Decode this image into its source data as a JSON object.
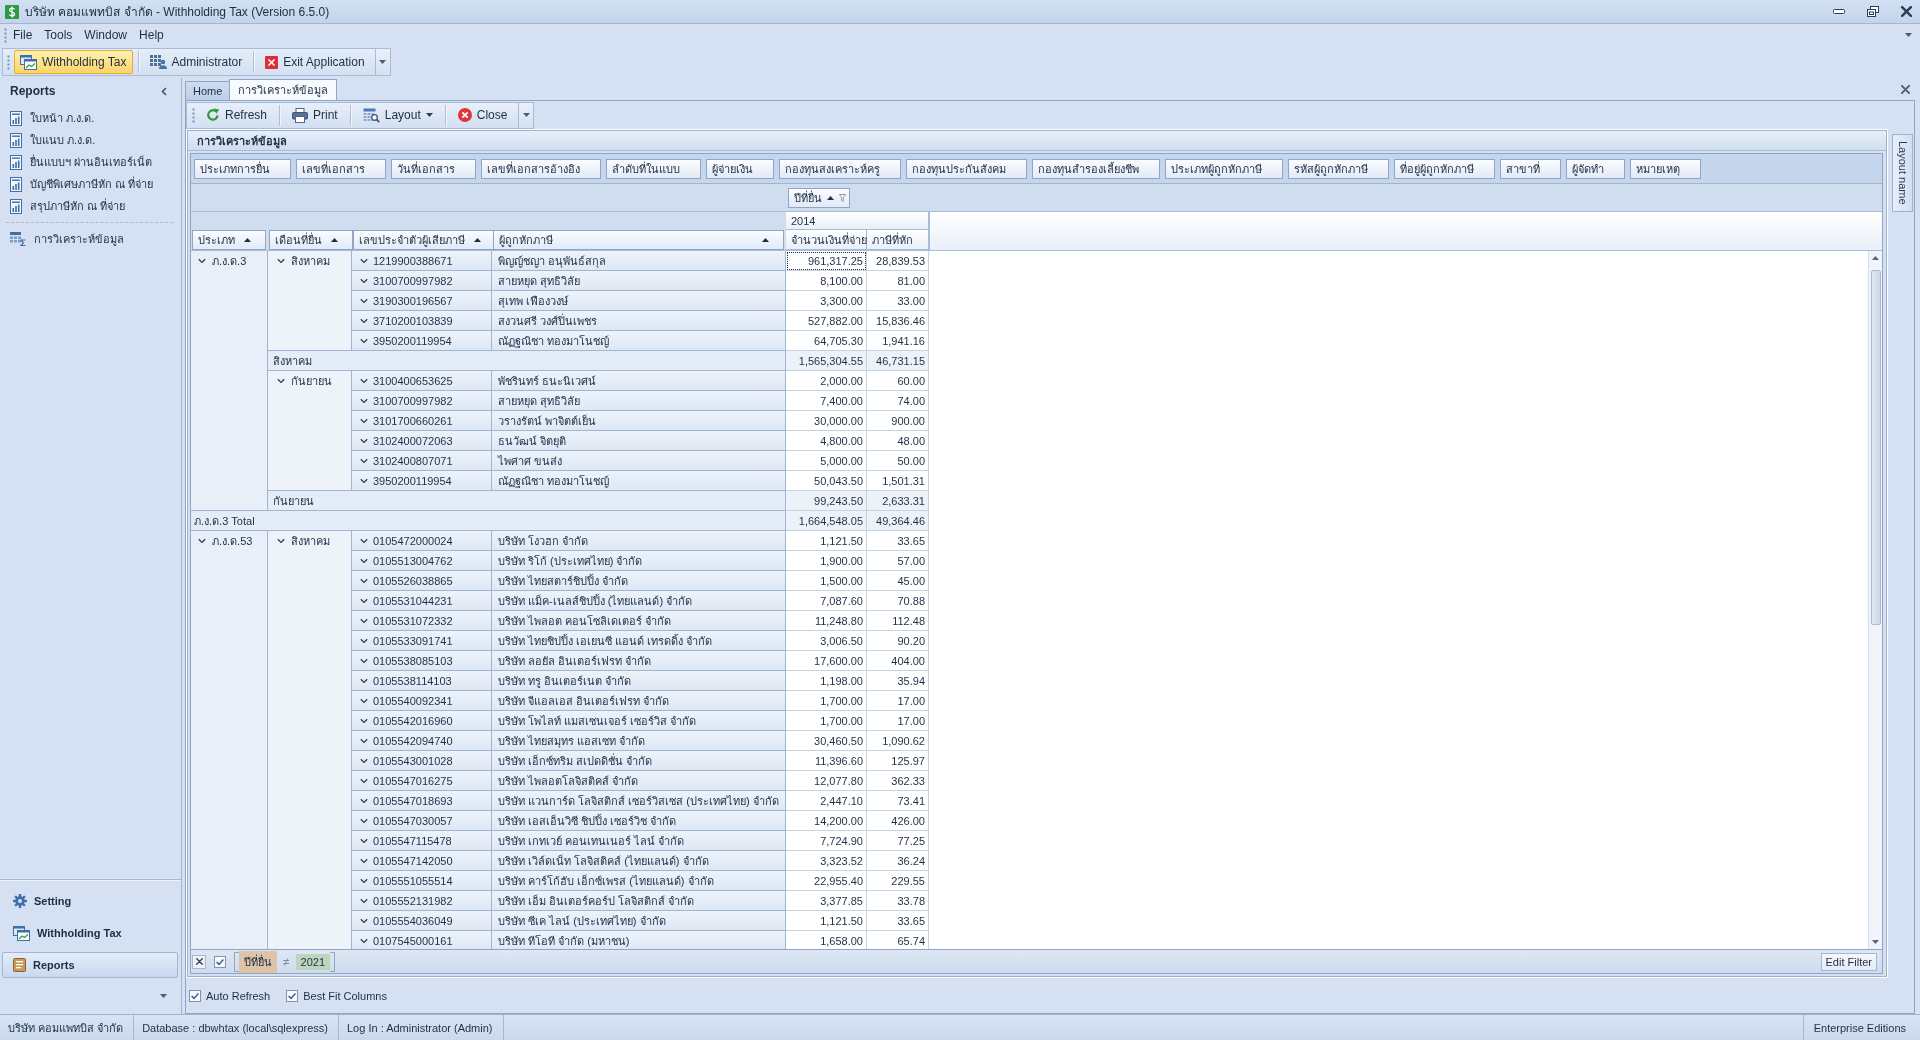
{
  "window": {
    "title": "บริษัท คอมแพทบิส จำกัด - Withholding Tax (Version 6.5.0)"
  },
  "menu": [
    "File",
    "Tools",
    "Window",
    "Help"
  ],
  "toolbar": [
    {
      "label": "Withholding Tax",
      "kind": "module",
      "selected": true
    },
    {
      "label": "Administrator",
      "kind": "admin",
      "selected": false
    },
    {
      "label": "Exit Application",
      "kind": "exit",
      "selected": false
    }
  ],
  "sidebar": {
    "title": "Reports",
    "items": [
      {
        "label": "ใบหน้า ภ.ง.ด.",
        "kind": "report",
        "selected": false
      },
      {
        "label": "ใบแนบ ภ.ง.ด.",
        "kind": "report",
        "selected": false
      },
      {
        "label": "ยื่นแบบฯ ผ่านอินเทอร์เน็ต",
        "kind": "report",
        "selected": false
      },
      {
        "label": "บัญชีพิเศษภาษีหัก ณ ที่จ่าย",
        "kind": "report",
        "selected": false
      },
      {
        "label": "สรุปภาษีหัก ณ ที่จ่าย",
        "kind": "report",
        "selected": false
      },
      {
        "label": "การวิเคราะห์ข้อมูล",
        "kind": "analysis",
        "selected": false
      }
    ],
    "sections": [
      {
        "label": "Setting",
        "kind": "setting",
        "selected": false
      },
      {
        "label": "Withholding Tax",
        "kind": "module",
        "selected": false
      },
      {
        "label": "Reports",
        "kind": "reports",
        "selected": true
      }
    ]
  },
  "tabs": [
    {
      "label": "Home",
      "selected": false
    },
    {
      "label": "การวิเคราะห์ข้อมูล",
      "selected": true
    }
  ],
  "document_toolbar": [
    {
      "label": "Refresh",
      "kind": "refresh",
      "dropdown": false
    },
    {
      "label": "Print",
      "kind": "print",
      "dropdown": false
    },
    {
      "label": "Layout",
      "kind": "layout",
      "dropdown": true
    },
    {
      "label": "Close",
      "kind": "close",
      "dropdown": false
    }
  ],
  "panel": {
    "title": "การวิเคราะห์ข้อมูล"
  },
  "pivot": {
    "filter_fields": [
      "ประเภทการยื่น",
      "เลขที่เอกสาร",
      "วันที่เอกสาร",
      "เลขที่เอกสารอ้างอิง",
      "ลำดับที่ในแบบ",
      "ผู้จ่ายเงิน",
      "กองทุนสงเคราะห์ครู",
      "กองทุนประกันสังคม",
      "กองทุนสำรองเลี้ยงชีพ",
      "ประเภทผู้ถูกหักภาษี",
      "รหัสผู้ถูกหักภาษี",
      "ที่อยู่ผู้ถูกหักภาษี",
      "สาขาที่",
      "ผู้จัดทำ",
      "หมายเหตุ"
    ],
    "column_fields": [
      {
        "label": "ปีที่ยื่น",
        "sorted": true,
        "filtered": true
      }
    ],
    "column_values": [
      "2014"
    ],
    "data_fields": [
      "จำนวนเงินที่จ่าย",
      "ภาษีที่หัก"
    ],
    "row_fields": [
      {
        "label": "ประเภท",
        "sorted": true
      },
      {
        "label": "เดือนที่ยื่น",
        "sorted": true
      },
      {
        "label": "เลขประจำตัวผู้เสียภาษี",
        "sorted": true
      },
      {
        "label": "ผู้ถูกหักภาษี",
        "sorted": true
      }
    ],
    "groups": [
      {
        "label": "ภ.ง.ด.3",
        "expanded": true,
        "children": [
          {
            "label": "สิงหาคม",
            "expanded": true,
            "children": [
              {
                "tax_id": "1219900388671",
                "name": "พิญญ์ชญา อนุพันธ์สกุล",
                "amount": "961,317.25",
                "tax": "28,839.53",
                "expanded": true,
                "focused": true
              },
              {
                "tax_id": "3100700997982",
                "name": "สายหยุด สุทธิวิลัย",
                "amount": "8,100.00",
                "tax": "81.00",
                "expanded": true,
                "focused": false
              },
              {
                "tax_id": "3190300196567",
                "name": "สุเทพ เฟืองวงษ์",
                "amount": "3,300.00",
                "tax": "33.00",
                "expanded": true,
                "focused": false
              },
              {
                "tax_id": "3710200103839",
                "name": "สงวนศรี วงศ์ปิ่นเพชร",
                "amount": "527,882.00",
                "tax": "15,836.46",
                "expanded": true,
                "focused": false
              },
              {
                "tax_id": "3950200119954",
                "name": "ณัฏฐณิชา ทองมาโนชญ์",
                "amount": "64,705.30",
                "tax": "1,941.16",
                "expanded": true,
                "focused": false
              }
            ],
            "total": {
              "label": "สิงหาคม",
              "amount": "1,565,304.55",
              "tax": "46,731.15"
            }
          },
          {
            "label": "กันยายน",
            "expanded": true,
            "children": [
              {
                "tax_id": "3100400653625",
                "name": "พัชรินทร์ ธนะนิเวศน์",
                "amount": "2,000.00",
                "tax": "60.00",
                "expanded": true,
                "focused": false
              },
              {
                "tax_id": "3100700997982",
                "name": "สายหยุด สุทธิวิลัย",
                "amount": "7,400.00",
                "tax": "74.00",
                "expanded": true,
                "focused": false
              },
              {
                "tax_id": "3101700660261",
                "name": "วรางรัตน์ พาจิตต์เย็น",
                "amount": "30,000.00",
                "tax": "900.00",
                "expanded": true,
                "focused": false
              },
              {
                "tax_id": "3102400072063",
                "name": "ธนวัฒน์ จิตยุติ",
                "amount": "4,800.00",
                "tax": "48.00",
                "expanded": true,
                "focused": false
              },
              {
                "tax_id": "3102400807071",
                "name": "ไพศาศ ขนส่ง",
                "amount": "5,000.00",
                "tax": "50.00",
                "expanded": true,
                "focused": false
              },
              {
                "tax_id": "3950200119954",
                "name": "ณัฏฐณิชา ทองมาโนชญ์",
                "amount": "50,043.50",
                "tax": "1,501.31",
                "expanded": true,
                "focused": false
              }
            ],
            "total": {
              "label": "กันยายน",
              "amount": "99,243.50",
              "tax": "2,633.31"
            }
          }
        ],
        "total": {
          "label": "ภ.ง.ด.3 Total",
          "amount": "1,664,548.05",
          "tax": "49,364.46"
        }
      },
      {
        "label": "ภ.ง.ด.53",
        "expanded": true,
        "children": [
          {
            "label": "สิงหาคม",
            "expanded": true,
            "children": [
              {
                "tax_id": "0105472000024",
                "name": "บริษัท โงวฮก จำกัด",
                "amount": "1,121.50",
                "tax": "33.65",
                "expanded": true,
                "focused": false
              },
              {
                "tax_id": "0105513004762",
                "name": "บริษัท ริโก้ (ประเทศไทย) จำกัด",
                "amount": "1,900.00",
                "tax": "57.00",
                "expanded": true,
                "focused": false
              },
              {
                "tax_id": "0105526038865",
                "name": "บริษัท ไทยสตาร์ชิปปิ้ง จำกัด",
                "amount": "1,500.00",
                "tax": "45.00",
                "expanded": true,
                "focused": false
              },
              {
                "tax_id": "0105531044231",
                "name": "บริษัท แม็ค-เนลส์ชิปปิ้ง (ไทยแลนด์) จำกัด",
                "amount": "7,087.60",
                "tax": "70.88",
                "expanded": true,
                "focused": false
              },
              {
                "tax_id": "0105531072332",
                "name": "บริษัท ไพลอต คอนโซลิเดเตอร์ จำกัด",
                "amount": "11,248.80",
                "tax": "112.48",
                "expanded": true,
                "focused": false
              },
              {
                "tax_id": "0105533091741",
                "name": "บริษัท ไทยชิปปิ้ง เอเยนซี แอนด์ เทรดดิ้ง จำกัด",
                "amount": "3,006.50",
                "tax": "90.20",
                "expanded": true,
                "focused": false
              },
              {
                "tax_id": "0105538085103",
                "name": "บริษัท ลอยัล อินเตอร์เฟรท จำกัด",
                "amount": "17,600.00",
                "tax": "404.00",
                "expanded": true,
                "focused": false
              },
              {
                "tax_id": "0105538114103",
                "name": "บริษัท ทรู อินเตอร์เนต จำกัด",
                "amount": "1,198.00",
                "tax": "35.94",
                "expanded": true,
                "focused": false
              },
              {
                "tax_id": "0105540092341",
                "name": "บริษัท จีแอลเอส อินเตอร์เฟรท จำกัด",
                "amount": "1,700.00",
                "tax": "17.00",
                "expanded": true,
                "focused": false
              },
              {
                "tax_id": "0105542016960",
                "name": "บริษัท โพไลท์ แมสเซนเจอร์ เซอร์วิส จำกัด",
                "amount": "1,700.00",
                "tax": "17.00",
                "expanded": true,
                "focused": false
              },
              {
                "tax_id": "0105542094740",
                "name": "บริษัท ไทยสมุทร แอสเซท จำกัด",
                "amount": "30,460.50",
                "tax": "1,090.62",
                "expanded": true,
                "focused": false
              },
              {
                "tax_id": "0105543001028",
                "name": "บริษัท เอ็กซ์ทริม สเปดดิชั่น จำกัด",
                "amount": "11,396.60",
                "tax": "125.97",
                "expanded": true,
                "focused": false
              },
              {
                "tax_id": "0105547016275",
                "name": "บริษัท ไพลอตโลจิสติคส์ จำกัด",
                "amount": "12,077.80",
                "tax": "362.33",
                "expanded": true,
                "focused": false
              },
              {
                "tax_id": "0105547018693",
                "name": "บริษัท แวนการ์ด โลจิสติกส์ เซอร์วิสเซส (ประเทศไทย) จำกัด",
                "amount": "2,447.10",
                "tax": "73.41",
                "expanded": true,
                "focused": false
              },
              {
                "tax_id": "0105547030057",
                "name": "บริษัท เอสเอ็นวิซี ชิปปิ้ง เซอร์วิช จำกัด",
                "amount": "14,200.00",
                "tax": "426.00",
                "expanded": true,
                "focused": false
              },
              {
                "tax_id": "0105547115478",
                "name": "บริษัท เกทเวย์ คอนเทนเนอร์ ไลน์ จำกัด",
                "amount": "7,724.90",
                "tax": "77.25",
                "expanded": true,
                "focused": false
              },
              {
                "tax_id": "0105547142050",
                "name": "บริษัท เวิล์ดเน็ท โลจิสติคส์ (ไทยแลนด์) จำกัด",
                "amount": "3,323.52",
                "tax": "36.24",
                "expanded": true,
                "focused": false
              },
              {
                "tax_id": "0105551055514",
                "name": "บริษัท คาร์โก้ฮับ เอ็กซ์เพรส (ไทยแลนด์) จำกัด",
                "amount": "22,955.40",
                "tax": "229.55",
                "expanded": true,
                "focused": false
              },
              {
                "tax_id": "0105552131982",
                "name": "บริษัท เอ็ม อินเตอร์คอร์ป โลจิสติกส์ จำกัด",
                "amount": "3,377.85",
                "tax": "33.78",
                "expanded": true,
                "focused": false
              },
              {
                "tax_id": "0105554036049",
                "name": "บริษัท ซีเค ไลน์ (ประเทศไทย) จำกัด",
                "amount": "1,121.50",
                "tax": "33.65",
                "expanded": true,
                "focused": false
              },
              {
                "tax_id": "0107545000161",
                "name": "บริษัท ทีโอที จำกัด (มหาชน)",
                "amount": "1,658.00",
                "tax": "65.74",
                "expanded": true,
                "focused": false
              }
            ]
          }
        ]
      }
    ]
  },
  "filter_bar": {
    "enabled": true,
    "field": "ปีที่ยื่น",
    "operator": "≠",
    "value": "2021",
    "button": "Edit Filter"
  },
  "layout_tab": "Layout name",
  "options": [
    {
      "label": "Auto Refresh",
      "checked": true
    },
    {
      "label": "Best Fit Columns",
      "checked": true
    }
  ],
  "status_bar": [
    "บริษัท คอมแพทบิส จำกัด",
    "Database : dbwhtax (local\\sqlexpress)",
    "Log In : Administrator (Admin)",
    "Enterprise Editions"
  ]
}
